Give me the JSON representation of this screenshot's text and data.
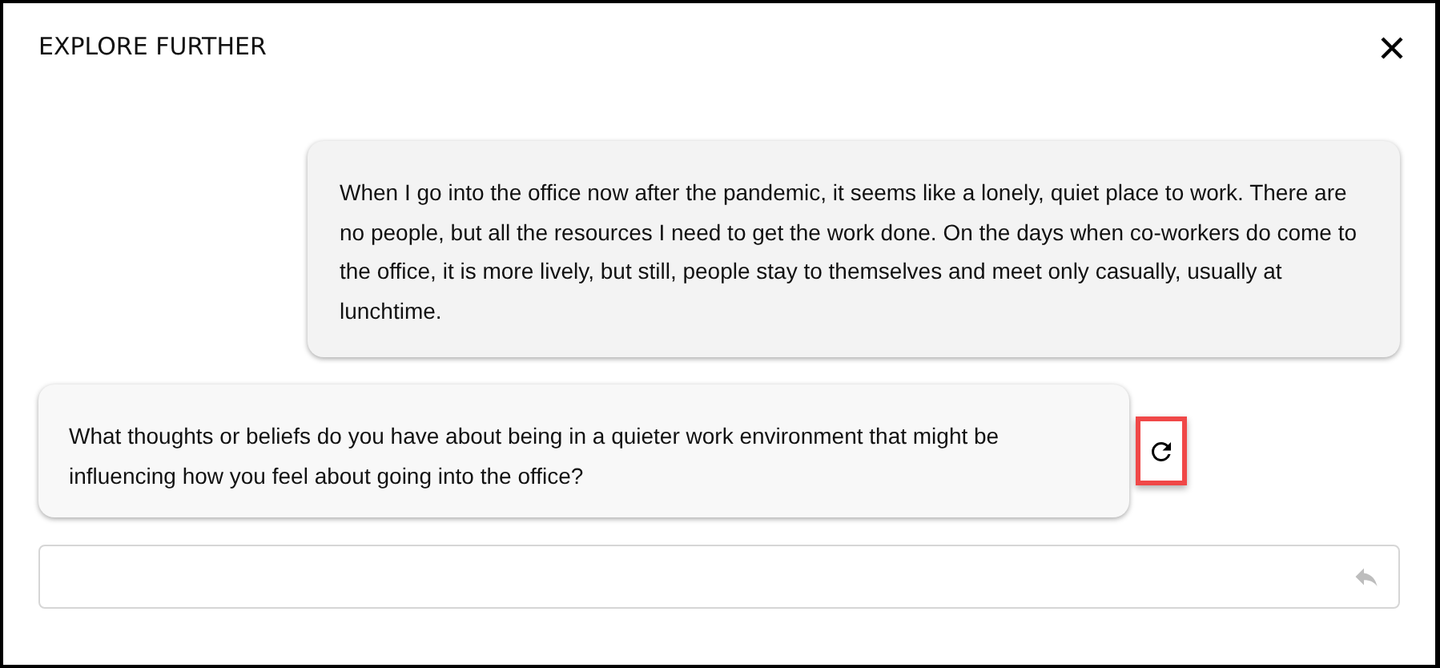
{
  "dialog": {
    "title": "EXPLORE FURTHER"
  },
  "messages": [
    {
      "kind": "user",
      "text": "When I go into the office now after the pandemic, it seems like a lonely, quiet place to work. There are no people, but all the resources I need to get the work done. On the days when co-workers do come to the office, it is more lively, but still, people stay to themselves and meet only casually, usually at lunchtime."
    },
    {
      "kind": "assistant",
      "text": "What thoughts or beliefs do you have about being in a quieter work environment that might be influencing how you feel about going into the office?",
      "refresh_highlighted": true
    }
  ],
  "reply": {
    "disabled": true
  }
}
